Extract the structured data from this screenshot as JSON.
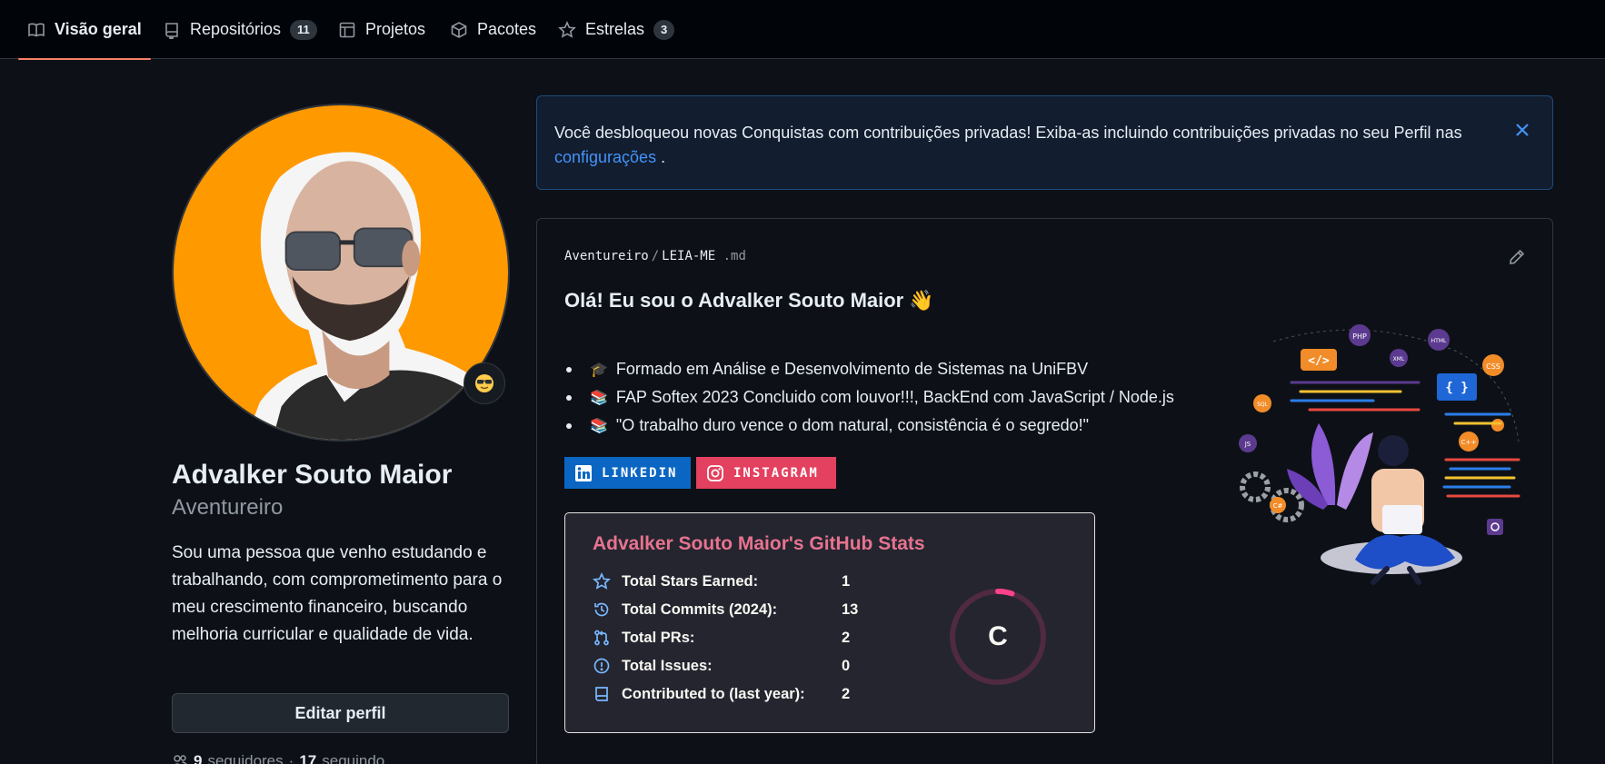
{
  "nav": {
    "tabs": [
      {
        "label": "Visão geral",
        "icon": "book-icon",
        "active": true
      },
      {
        "label": "Repositórios",
        "icon": "repo-icon",
        "count": "11"
      },
      {
        "label": "Projetos",
        "icon": "table-icon"
      },
      {
        "label": "Pacotes",
        "icon": "package-icon"
      },
      {
        "label": "Estrelas",
        "icon": "star-icon",
        "count": "3"
      }
    ]
  },
  "profile": {
    "fullname": "Advalker Souto Maior",
    "username": "Aventureiro",
    "status_emoji_icon": "sunglasses-emoji-icon",
    "bio": "Sou uma pessoa que venho estudando e trabalhando, com comprometimento para o meu crescimento financeiro, buscando melhoria curricular e qualidade de vida.",
    "edit_label": "Editar perfil",
    "followers_count": "9",
    "followers_label": "seguidores",
    "separator": "·",
    "following_count": "17",
    "following_label": "seguindo"
  },
  "banner": {
    "text": "Você desbloqueou novas Conquistas com contribuições privadas! Exiba-as incluindo contribuições privadas no seu Perfil nas",
    "link": "configurações",
    "suffix": " ."
  },
  "readme": {
    "owner": "Aventureiro",
    "slash": "/",
    "file": "LEIA-ME",
    "ext": ".md",
    "title": "Olá! Eu sou o Advalker Souto Maior 👋",
    "bullets": [
      {
        "emoji": "🎓",
        "text": "Formado em Análise e Desenvolvimento de Sistemas na UniFBV"
      },
      {
        "emoji": "📚",
        "text": "FAP Softex 2023 Concluido com louvor!!!, BackEnd com JavaScript / Node.js"
      },
      {
        "emoji": "📚",
        "text": "\"O trabalho duro vence o dom natural, consistência é o segredo!\""
      }
    ],
    "badges": {
      "linkedin": "LINKEDIN",
      "instagram": "INSTAGRAM"
    },
    "illustration_icon": "developer-illustration-icon"
  },
  "stats": {
    "title": "Advalker Souto Maior's GitHub Stats",
    "rows": [
      {
        "label": "Total Stars Earned:",
        "value": "1",
        "icon": "star-icon"
      },
      {
        "label": "Total Commits (2024):",
        "value": "13",
        "icon": "history-icon"
      },
      {
        "label": "Total PRs:",
        "value": "2",
        "icon": "pull-request-icon"
      },
      {
        "label": "Total Issues:",
        "value": "0",
        "icon": "issue-icon"
      },
      {
        "label": "Contributed to (last year):",
        "value": "2",
        "icon": "repo-icon"
      }
    ],
    "rank": "C",
    "rank_progress": 0.05,
    "colors": {
      "title": "#e7738f",
      "icon": "#79b8ff",
      "ring": "#fe428e",
      "bg": "#24252f"
    }
  },
  "colors": {
    "accent_link": "#4493f8",
    "tab_underline": "#f78166",
    "avatar_bg": "#ff9900"
  }
}
